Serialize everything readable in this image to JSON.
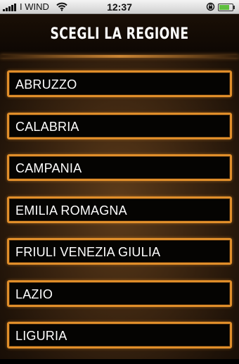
{
  "statusbar": {
    "carrier": "I WIND",
    "time": "12:37",
    "battery_level": 0.75
  },
  "header": {
    "title": "SCEGLI LA REGIONE"
  },
  "regions": [
    {
      "label": "ABRUZZO"
    },
    {
      "label": "CALABRIA"
    },
    {
      "label": "CAMPANIA"
    },
    {
      "label": "EMILIA ROMAGNA"
    },
    {
      "label": "FRIULI VENEZIA GIULIA"
    },
    {
      "label": "LAZIO"
    },
    {
      "label": "LIGURIA"
    }
  ],
  "colors": {
    "accent": "#e08e2a",
    "background": "#3a2410",
    "item_fill": "#050402"
  }
}
